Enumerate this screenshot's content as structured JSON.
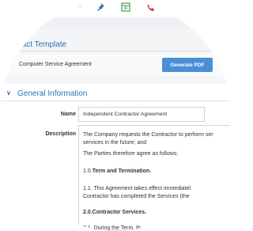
{
  "toolbar": {
    "icons": [
      "menu-dots-icon",
      "pin-icon",
      "grid-icon",
      "phone-icon"
    ]
  },
  "contract_template": {
    "title": "ntract Template",
    "selected_value": "Computer Service Agreement",
    "generate_button": "Generate PDF"
  },
  "general_information": {
    "title": "General Information",
    "name_label": "Name",
    "name_value": "Independent Contractor Agreement",
    "description_label": "Description",
    "description_lines": [
      "The Company requests the Contractor to perform ser",
      "services in the future; and",
      "The Parties therefore agree as follows:",
      "1.0.Term and Termination.",
      "1.1. This Agreement takes effect immediatel",
      "Contractor has completed the Services (the",
      "2.0.Contractor Services.",
      "2.1.  During the Term, th"
    ]
  },
  "colors": {
    "accent": "#2b72b8",
    "button": "#4a8fd6"
  }
}
